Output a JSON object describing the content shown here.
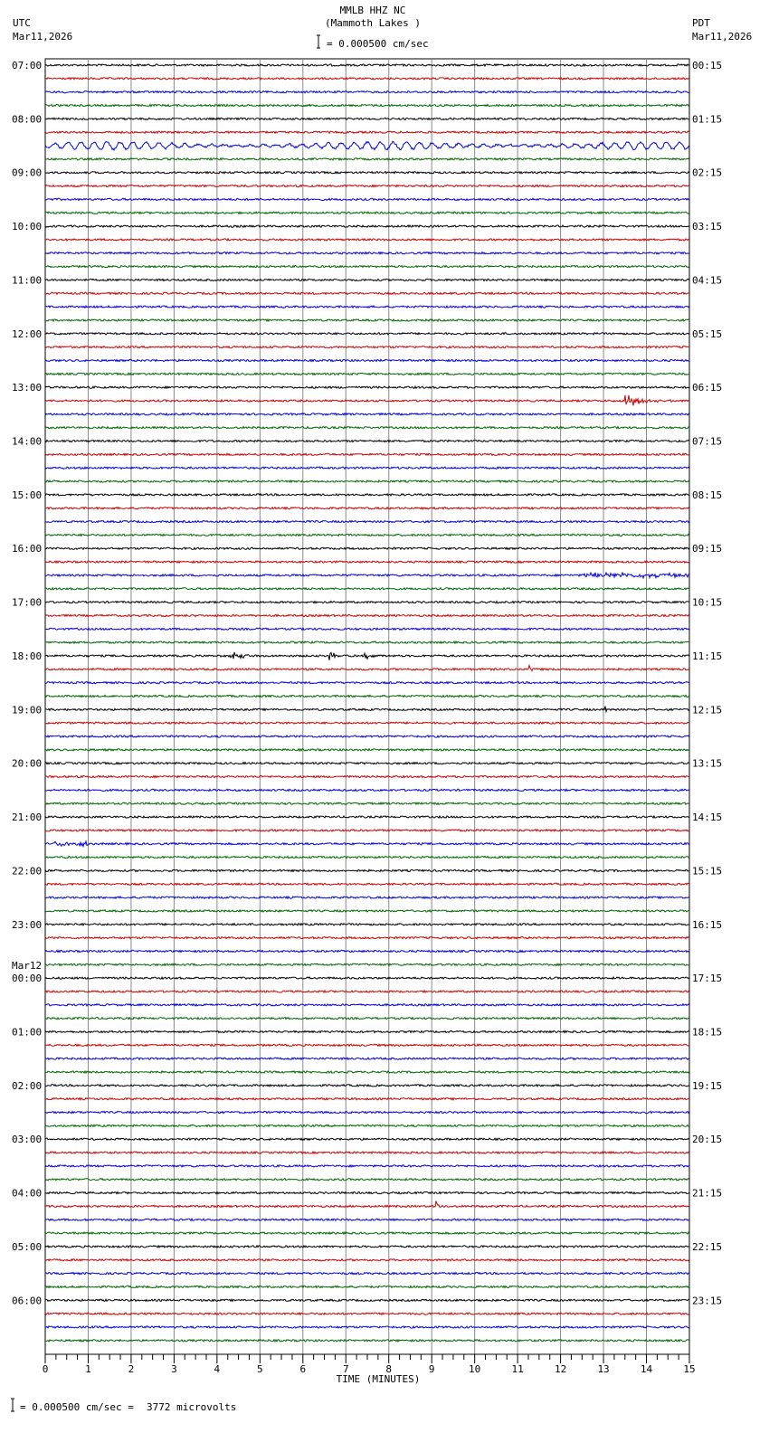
{
  "chart_data": {
    "type": "line",
    "title": "MMLB HHZ NC",
    "subtitle": "(Mammoth Lakes )",
    "scale_label": "= 0.000500 cm/sec",
    "left_header": {
      "tz": "UTC",
      "date": "Mar11,2026"
    },
    "right_header": {
      "tz": "PDT",
      "date": "Mar11,2026"
    },
    "xlabel": "TIME (MINUTES)",
    "xlim": [
      0,
      15
    ],
    "xticks": [
      "0",
      "1",
      "2",
      "3",
      "4",
      "5",
      "6",
      "7",
      "8",
      "9",
      "10",
      "11",
      "12",
      "13",
      "14",
      "15"
    ],
    "grid": true,
    "traces_per_hour": 4,
    "trace_colors": [
      "#000000",
      "#cc0000",
      "#0000dd",
      "#006600"
    ],
    "left_labels": [
      "07:00",
      "08:00",
      "09:00",
      "10:00",
      "11:00",
      "12:00",
      "13:00",
      "14:00",
      "15:00",
      "16:00",
      "17:00",
      "18:00",
      "19:00",
      "20:00",
      "21:00",
      "22:00",
      "23:00",
      "00:00",
      "01:00",
      "02:00",
      "03:00",
      "04:00",
      "05:00",
      "06:00"
    ],
    "left_date_change": {
      "before_index": 17,
      "label": "Mar12"
    },
    "right_labels": [
      "00:15",
      "01:15",
      "02:15",
      "03:15",
      "04:15",
      "05:15",
      "06:15",
      "07:15",
      "08:15",
      "09:15",
      "10:15",
      "11:15",
      "12:15",
      "13:15",
      "14:15",
      "15:15",
      "16:15",
      "17:15",
      "18:15",
      "19:15",
      "20:15",
      "21:15",
      "22:15",
      "23:15"
    ],
    "events": [
      {
        "trace": 6,
        "minute_start": 0,
        "minute_end": 15,
        "amplitude": 4,
        "kind": "oscillation"
      },
      {
        "trace": 25,
        "minute_start": 13.5,
        "minute_end": 14.6,
        "amplitude": 9,
        "kind": "quake"
      },
      {
        "trace": 38,
        "minute_start": 12.5,
        "minute_end": 15,
        "amplitude": 4,
        "kind": "noise"
      },
      {
        "trace": 44,
        "minute_start": 4.3,
        "minute_end": 4.9,
        "amplitude": 7,
        "kind": "quake"
      },
      {
        "trace": 44,
        "minute_start": 6.6,
        "minute_end": 7.0,
        "amplitude": 6,
        "kind": "quake"
      },
      {
        "trace": 44,
        "minute_start": 7.4,
        "minute_end": 8.0,
        "amplitude": 5,
        "kind": "quake"
      },
      {
        "trace": 45,
        "minute_start": 11.25,
        "minute_end": 11.5,
        "amplitude": 7,
        "kind": "quake"
      },
      {
        "trace": 48,
        "minute_start": 13.0,
        "minute_end": 13.2,
        "amplitude": 6,
        "kind": "quake"
      },
      {
        "trace": 85,
        "minute_start": 9.1,
        "minute_end": 9.4,
        "amplitude": 6,
        "kind": "quake"
      },
      {
        "trace": 58,
        "minute_start": 0.2,
        "minute_end": 1.0,
        "amplitude": 4,
        "kind": "noise"
      }
    ]
  },
  "footer": {
    "scale_label": "= 0.000500 cm/sec =",
    "microvolts": "3772 microvolts"
  }
}
